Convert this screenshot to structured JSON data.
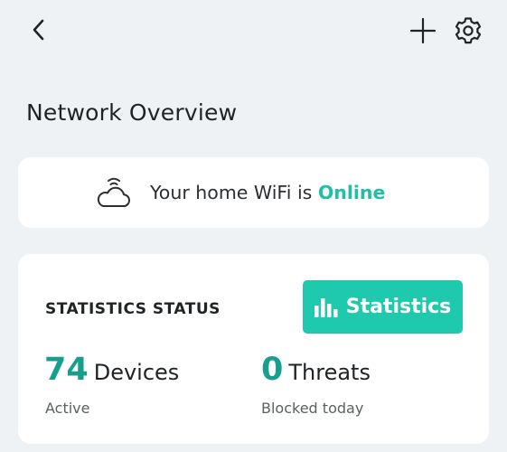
{
  "header": {
    "back_icon": "chevron-left-icon",
    "add_icon": "plus-icon",
    "settings_icon": "gear-icon"
  },
  "page": {
    "title": "Network Overview"
  },
  "wifi_card": {
    "icon": "cloud-wifi-icon",
    "text_prefix": "Your home WiFi is",
    "status": "Online",
    "status_color": "#1fc0a7"
  },
  "stats_card": {
    "heading": "STATISTICS STATUS",
    "button_label": "Statistics",
    "button_icon": "bar-chart-icon",
    "button_color": "#1ec9ad",
    "devices": {
      "value": "74",
      "label": "Devices",
      "sublabel": "Active"
    },
    "threats": {
      "value": "0",
      "label": "Threats",
      "sublabel": "Blocked today"
    },
    "value_color": "#179e8c"
  },
  "colors": {
    "background": "#eff2f5",
    "card": "#ffffff"
  }
}
